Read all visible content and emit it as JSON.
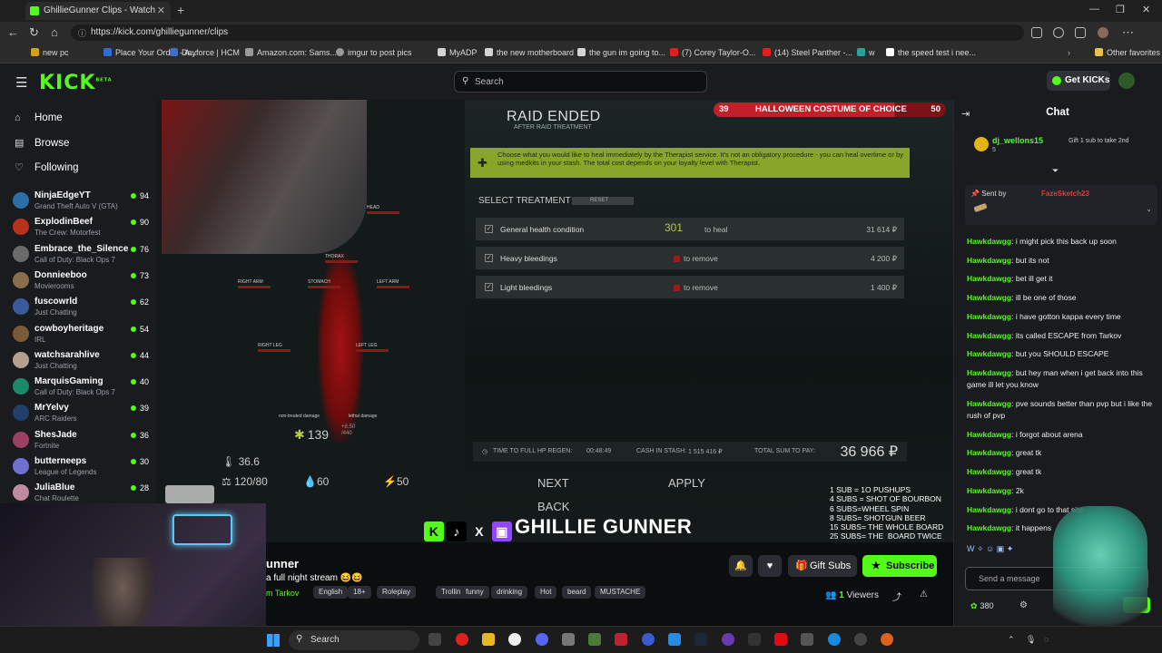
{
  "browser": {
    "tab_title": "GhillieGunner Clips - Watch",
    "url": "https://kick.com/ghilliegunner/clips",
    "bookmarks": [
      "new pc",
      "Place Your Order - A...",
      "Dayforce | HCM",
      "Amazon.com: Sams...",
      "imgur to post pics",
      "MyADP",
      "the new motherboard",
      "the gun im going to...",
      "(7) Corey Taylor-O...",
      "(14) Steel Panther -...",
      "w",
      "the speed test i nee...",
      "Other favorites"
    ],
    "bookmark_colors": [
      "#d4a017",
      "#2f6fd4",
      "#3b6fd1",
      "#999999",
      "#999999",
      "#d4d4d4",
      "#d4d4d4",
      "#d4d4d4",
      "#e02020",
      "#e02020",
      "#2aa198",
      "#ffffff",
      "#e8c24a"
    ]
  },
  "header": {
    "logo": "KICK",
    "logo_sup": "BETA",
    "search_placeholder": "Search",
    "get_kicks": "Get KICKs"
  },
  "sidebar": {
    "nav": [
      {
        "label": "Home",
        "icon": "home-icon"
      },
      {
        "label": "Browse",
        "icon": "browse-icon"
      },
      {
        "label": "Following",
        "icon": "heart-icon"
      }
    ],
    "channels": [
      {
        "name": "NinjaEdgeYT",
        "game": "Grand Theft Auto V (GTA)",
        "viewers": "94",
        "color": "#2a6fa8"
      },
      {
        "name": "ExplodinBeef",
        "game": "The Crew: Motorfest",
        "viewers": "90",
        "color": "#b8321a"
      },
      {
        "name": "Embrace_the_Silence",
        "game": "Call of Duty: Black Ops 7",
        "viewers": "76",
        "color": "#6b6b6b"
      },
      {
        "name": "Donnieeboo",
        "game": "Movierooms",
        "viewers": "73",
        "color": "#8a6d4a"
      },
      {
        "name": "fuscowrld",
        "game": "Just Chatting",
        "viewers": "62",
        "color": "#3a5a9a"
      },
      {
        "name": "cowboyheritage",
        "game": "IRL",
        "viewers": "54",
        "color": "#7a5a3a"
      },
      {
        "name": "watchsarahlive",
        "game": "Just Chatting",
        "viewers": "44",
        "color": "#b5a090"
      },
      {
        "name": "MarquisGaming",
        "game": "Call of Duty: Black Ops 7",
        "viewers": "40",
        "color": "#1a8a6a"
      },
      {
        "name": "MrYelvy",
        "game": "ARC Raiders",
        "viewers": "39",
        "color": "#20406a"
      },
      {
        "name": "ShesJade",
        "game": "Fortnite",
        "viewers": "36",
        "color": "#9a4060"
      },
      {
        "name": "butterneeps",
        "game": "League of Legends",
        "viewers": "30",
        "color": "#7070d0"
      },
      {
        "name": "JuliaBlue",
        "game": "Chat Roulette",
        "viewers": "28",
        "color": "#c08aa0"
      }
    ]
  },
  "game": {
    "raid_title": "RAID ENDED",
    "raid_sub": "AFTER RAID TREATMENT",
    "goal_current": "39",
    "goal_label": "HALLOWEEN COSTUME OF CHOICE",
    "goal_target": "50",
    "goal_progress": 0.78,
    "info_text": "Choose what you would like to heal immediately by the Therapist service. It's not an obligatory procedure - you can heal overtime or by using medkits in your stash. The total cost depends on your loyalty level with Therapist.",
    "select_treatment": "SELECT TREATMENT",
    "reset": "RESET",
    "treatments": [
      {
        "name": "General health condition",
        "middle": "to heal",
        "amount": "301",
        "cost": "31 614 ₽"
      },
      {
        "name": "Heavy bleedings",
        "middle": "to remove",
        "amount": "",
        "cost": "4 200 ₽"
      },
      {
        "name": "Light bleedings",
        "middle": "to remove",
        "amount": "",
        "cost": "1 400 ₽"
      }
    ],
    "body_parts": {
      "head": "HEAD",
      "thorax": "THORAX",
      "right_arm": "RIGHT ARM",
      "stomach": "STOMACH",
      "left_arm": "LEFT ARM",
      "right_leg": "RIGHT LEG",
      "left_leg": "LEFT LEG"
    },
    "hp": "139",
    "hp_regen_rate": "+8.50",
    "hp_max": "/440",
    "temperature": "36.6",
    "weight": "120/80",
    "hydration": "60",
    "energy": "50",
    "legend_non_treated": "non-treated damage",
    "legend_lethal": "lethal damage",
    "time_to_full": "TIME TO FULL HP REGEN:",
    "time_value": "00:48:49",
    "cash_label": "CASH IN STASH:",
    "cash_value": "1 515 416 ₽",
    "total_label": "TOTAL SUM TO PAY:",
    "total_value": "36 966 ₽",
    "next": "NEXT",
    "apply": "APPLY",
    "back": "BACK",
    "sub_rules": "1 SUB = 1O PUSHUPS\n4 SUBS = SHOT OF BOURBON\n6 SUBS=WHEEL SPIN\n8 SUBS= SHOTGUN BEER\n15 SUBS= THE WHOLE BOARD\n25 SUBS= THE  BOARD TWICE",
    "brand_name": "GHILLIE GUNNER",
    "brand_small": "TikTok"
  },
  "stream": {
    "streamer": "unner",
    "title": "a full night stream 😆😆",
    "category": "m Tarkov",
    "tags": [
      "English",
      "18+",
      "Roleplay",
      "Trolling",
      "funny",
      "drinking",
      "Hot",
      "beard",
      "MUSTACHE"
    ],
    "viewers_count": "1",
    "viewers_label": "Viewers",
    "gift_subs": "Gift Subs",
    "subscribe": "Subscribe"
  },
  "chat": {
    "title": "Chat",
    "pinned_user": "dj_wellons15",
    "pinned_count": "5",
    "pinned_gift": "Gift 1 sub to take 2nd",
    "sent_by_label": "Sent by",
    "sent_by_user": "FazeSketch23",
    "messages": [
      {
        "user": "Hawkdawgg",
        "text": "i might pick this back up soon"
      },
      {
        "user": "Hawkdawgg",
        "text": "but its not"
      },
      {
        "user": "Hawkdawgg",
        "text": "bet ill get it"
      },
      {
        "user": "Hawkdawgg",
        "text": "ill be one of those"
      },
      {
        "user": "Hawkdawgg",
        "text": "i have gotton kappa every time"
      },
      {
        "user": "Hawkdawgg",
        "text": "its called ESCAPE from Tarkov"
      },
      {
        "user": "Hawkdawgg",
        "text": "but you SHOULD ESCAPE"
      },
      {
        "user": "Hawkdawgg",
        "text": "but hey man when i get back into this game ill let you know"
      },
      {
        "user": "Hawkdawgg",
        "text": "pve sounds better than pvp but i like the rush of pvp"
      },
      {
        "user": "Hawkdawgg",
        "text": "i forgot about arena"
      },
      {
        "user": "Hawkdawgg",
        "text": "great tk"
      },
      {
        "user": "Hawkdawgg",
        "text": "great tk"
      },
      {
        "user": "Hawkdawgg",
        "text": "2k"
      },
      {
        "user": "Hawkdawgg",
        "text": "i dont go to that site"
      },
      {
        "user": "Hawkdawgg",
        "text": "it happens"
      }
    ],
    "input_placeholder": "Send a message",
    "points": "380"
  },
  "taskbar": {
    "search": "Search"
  }
}
